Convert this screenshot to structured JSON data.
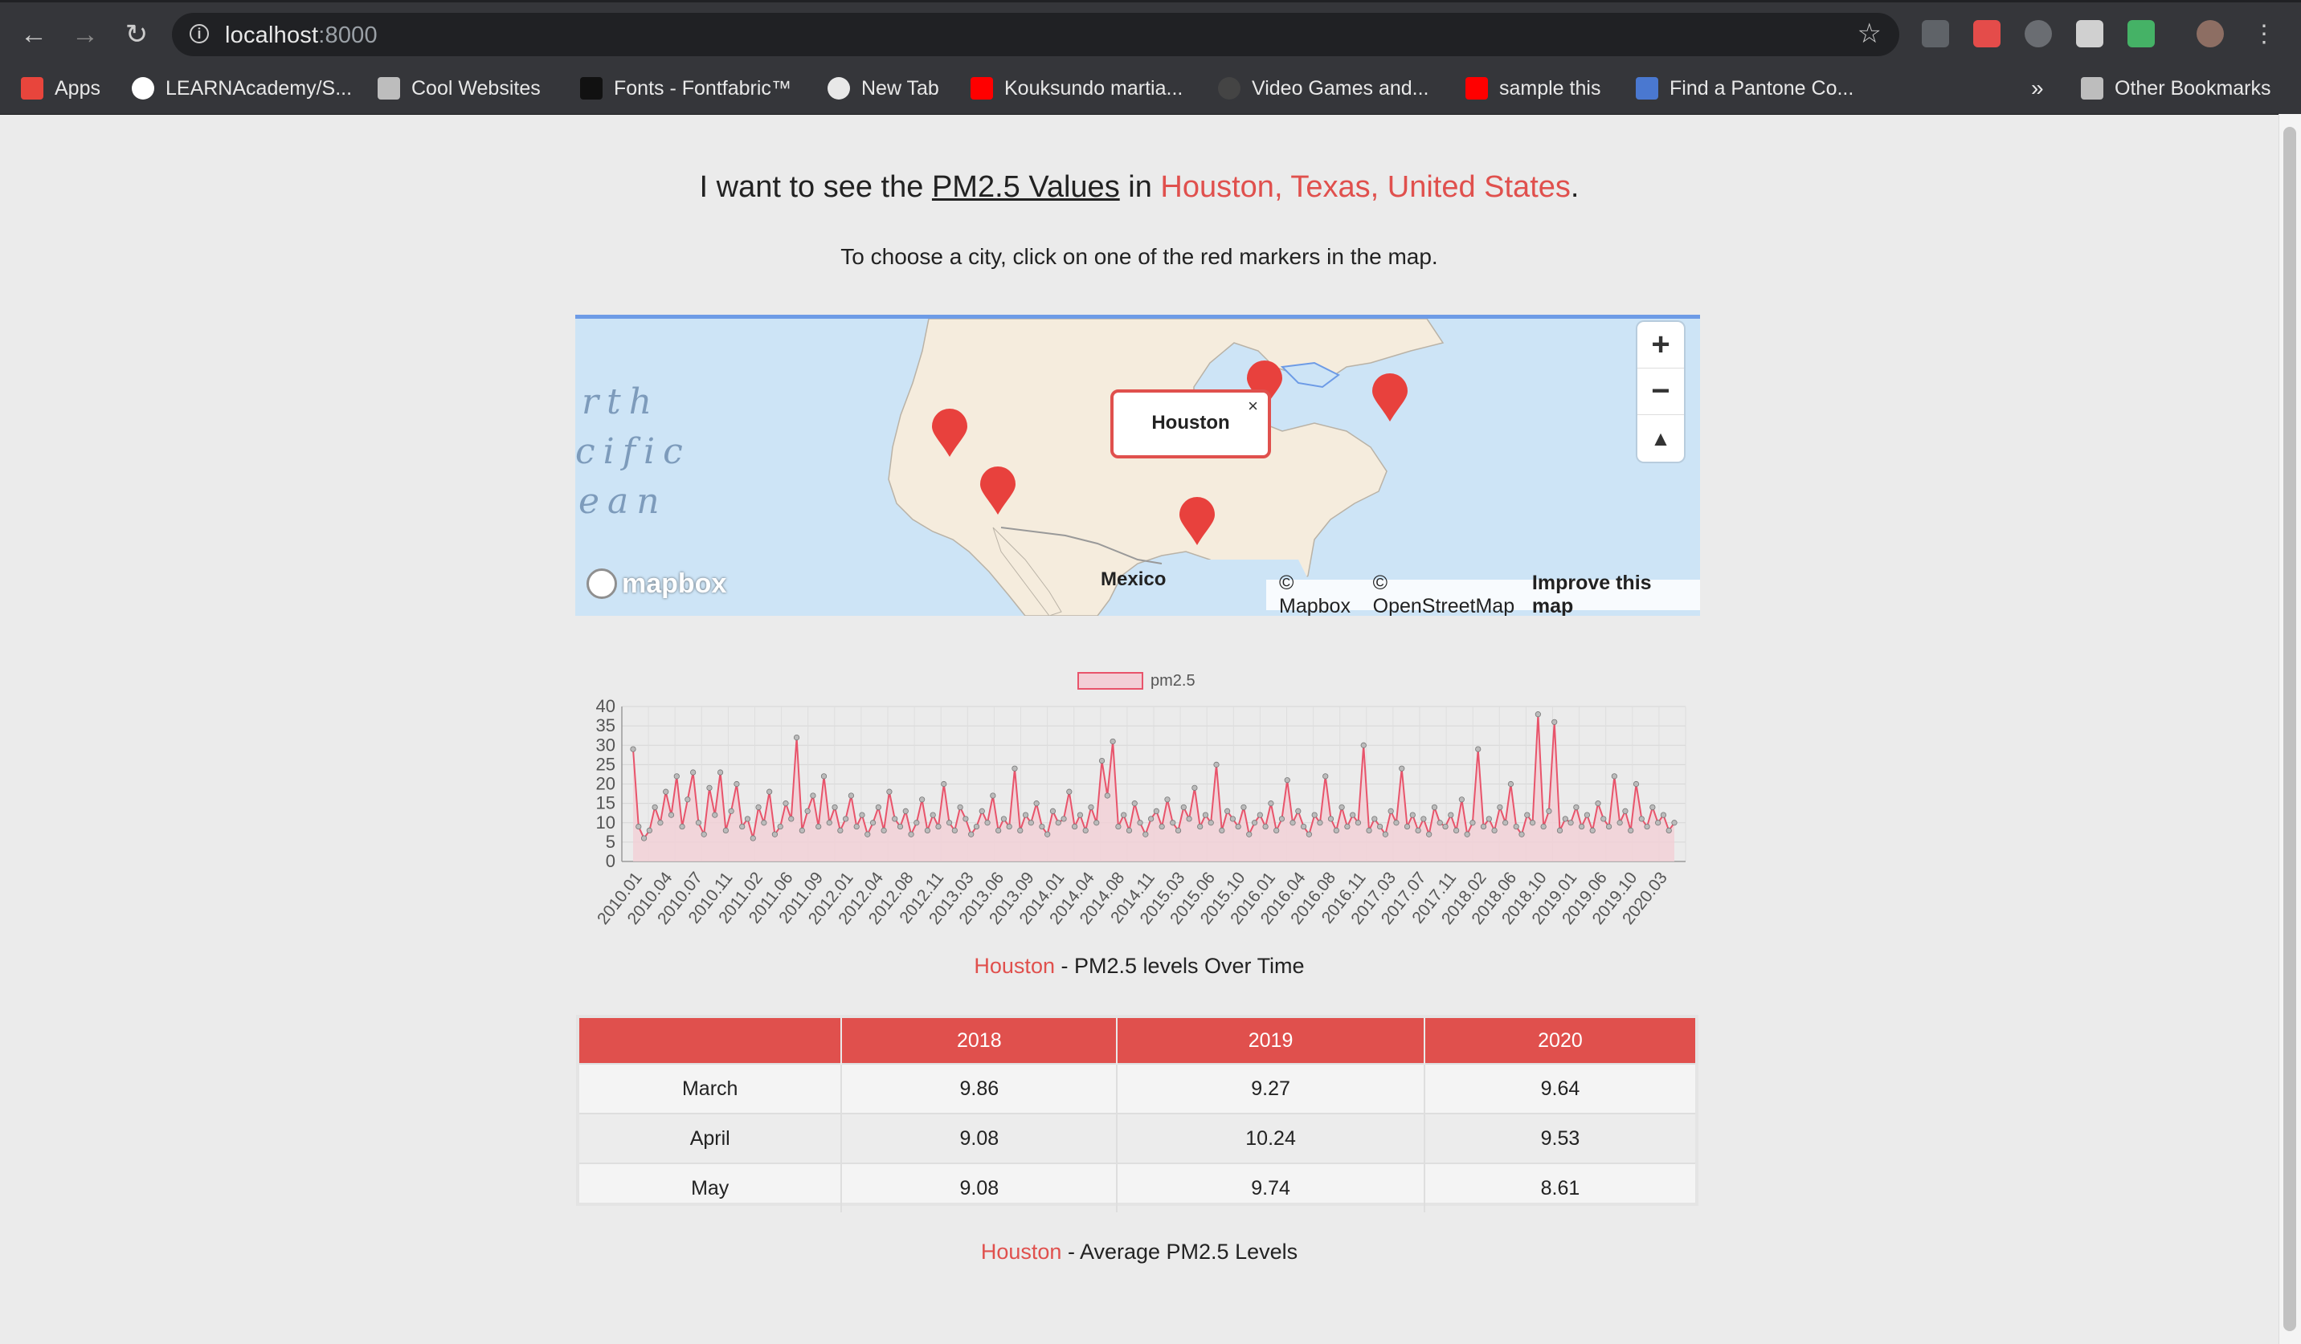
{
  "browser": {
    "url_host": "localhost",
    "url_port": ":8000",
    "bookmarks": [
      {
        "label": "Apps",
        "icon": "apps-grid-icon",
        "color": "#e8453c"
      },
      {
        "label": "LEARNAcademy/S...",
        "icon": "github-icon",
        "color": "#ffffff"
      },
      {
        "label": "Cool Websites",
        "icon": "folder-icon",
        "color": "#bdbdbd"
      },
      {
        "label": "Fonts - Fontfabric™",
        "icon": "fontfabric-icon",
        "color": "#111111"
      },
      {
        "label": "New Tab",
        "icon": "globe-icon",
        "color": "#e8e8e8"
      },
      {
        "label": "Kouksundo martia...",
        "icon": "youtube-icon",
        "color": "#ff0000"
      },
      {
        "label": "Video Games and...",
        "icon": "quora-icon",
        "color": "#444444"
      },
      {
        "label": "sample this",
        "icon": "youtube-icon",
        "color": "#ff0000"
      },
      {
        "label": "Find a Pantone Co...",
        "icon": "pantone-icon",
        "color": "#4a78d0"
      }
    ],
    "overflow_label": "»",
    "other_bookmarks": "Other Bookmarks"
  },
  "header": {
    "prefix": "I want to see the",
    "metric": "PM2.5 Values",
    "connector": "in",
    "city": "Houston, Texas, United States",
    "suffix": ".",
    "instruction": "To choose a city, click on one of the red markers in the map."
  },
  "map": {
    "ocean_lines": [
      "rth",
      "cific",
      "ean"
    ],
    "popup_label": "Houston",
    "popup_close": "×",
    "country_label": "Mexico",
    "logo_text": "mapbox",
    "attribution": [
      "© Mapbox",
      "© OpenStreetMap"
    ],
    "improve_link": "Improve this map",
    "zoom_in": "+",
    "zoom_out": "−",
    "compass": "▲",
    "marker_color": "#e8413d"
  },
  "chart_data": {
    "type": "line",
    "title": "",
    "xlabel": "",
    "ylabel": "",
    "ylim": [
      0,
      40
    ],
    "yticks": [
      0,
      5,
      10,
      15,
      20,
      25,
      30,
      35,
      40
    ],
    "grid": true,
    "legend_position": "top",
    "x_tick_labels": [
      "2010.01",
      "2010.04",
      "2010.07",
      "2010.11",
      "2011.02",
      "2011.06",
      "2011.09",
      "2012.01",
      "2012.04",
      "2012.08",
      "2012.11",
      "2013.03",
      "2013.06",
      "2013.09",
      "2014.01",
      "2014.04",
      "2014.08",
      "2014.11",
      "2015.03",
      "2015.06",
      "2015.10",
      "2016.01",
      "2016.04",
      "2016.08",
      "2016.11",
      "2017.03",
      "2017.07",
      "2017.11",
      "2018.02",
      "2018.06",
      "2018.10",
      "2019.01",
      "2019.06",
      "2019.10",
      "2020.03"
    ],
    "series": [
      {
        "name": "pm2.5",
        "color": "#e8546b",
        "fill": "#f3cfd6",
        "values": [
          29,
          9,
          6,
          8,
          14,
          10,
          18,
          12,
          22,
          9,
          16,
          23,
          10,
          7,
          19,
          12,
          23,
          8,
          13,
          20,
          9,
          11,
          6,
          14,
          10,
          18,
          7,
          9,
          15,
          11,
          32,
          8,
          13,
          17,
          9,
          22,
          10,
          14,
          8,
          11,
          17,
          9,
          12,
          7,
          10,
          14,
          8,
          18,
          11,
          9,
          13,
          7,
          10,
          16,
          8,
          12,
          9,
          20,
          10,
          8,
          14,
          11,
          7,
          9,
          13,
          10,
          17,
          8,
          11,
          9,
          24,
          8,
          12,
          10,
          15,
          9,
          7,
          13,
          10,
          11,
          18,
          9,
          12,
          8,
          14,
          10,
          26,
          17,
          31,
          9,
          12,
          8,
          15,
          10,
          7,
          11,
          13,
          9,
          16,
          10,
          8,
          14,
          11,
          19,
          9,
          12,
          10,
          25,
          8,
          13,
          11,
          9,
          14,
          7,
          10,
          12,
          9,
          15,
          8,
          11,
          21,
          10,
          13,
          9,
          7,
          12,
          10,
          22,
          11,
          8,
          14,
          9,
          12,
          10,
          30,
          8,
          11,
          9,
          7,
          13,
          10,
          24,
          9,
          12,
          8,
          11,
          7,
          14,
          10,
          9,
          12,
          8,
          16,
          7,
          10,
          29,
          9,
          11,
          8,
          14,
          10,
          20,
          9,
          7,
          12,
          10,
          38,
          9,
          13,
          36,
          8,
          11,
          10,
          14,
          9,
          12,
          8,
          15,
          11,
          9,
          22,
          10,
          13,
          8,
          20,
          11,
          9,
          14,
          10,
          12,
          8,
          10
        ]
      }
    ]
  },
  "chart_caption": {
    "city": "Houston",
    "text": " - PM2.5 levels Over Time"
  },
  "table": {
    "headers": [
      "",
      "2018",
      "2019",
      "2020"
    ],
    "rows": [
      [
        "March",
        "9.86",
        "9.27",
        "9.64"
      ],
      [
        "April",
        "9.08",
        "10.24",
        "9.53"
      ],
      [
        "May",
        "9.08",
        "9.74",
        "8.61"
      ]
    ]
  },
  "table_caption": {
    "city": "Houston",
    "text": " - Average PM2.5 Levels"
  }
}
